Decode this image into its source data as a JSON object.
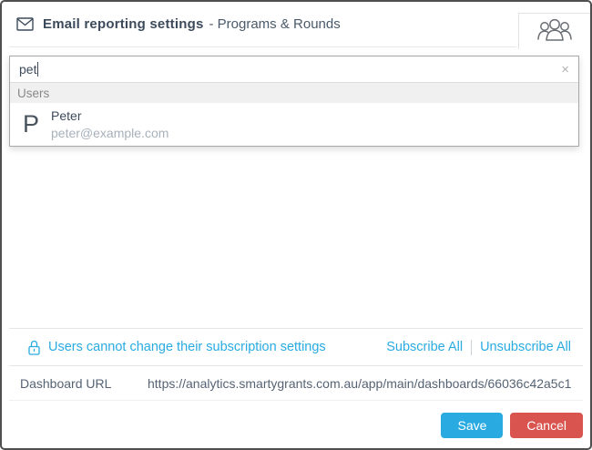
{
  "header": {
    "title": "Email reporting settings",
    "subtitle": "- Programs & Rounds"
  },
  "search": {
    "value": "pet",
    "clear_icon": "×"
  },
  "dropdown": {
    "group_label": "Users",
    "results": [
      {
        "avatar": "P",
        "name": "Peter",
        "email": "peter@example.com"
      }
    ]
  },
  "subscription": {
    "lock_text": "Users cannot change their subscription settings",
    "subscribe_all": "Subscribe All",
    "unsubscribe_all": "Unsubscribe All"
  },
  "dashboard": {
    "label": "Dashboard URL",
    "url": "https://analytics.smartygrants.com.au/app/main/dashboards/66036c42a5c1"
  },
  "footer": {
    "save": "Save",
    "cancel": "Cancel"
  },
  "colors": {
    "accent_blue": "#29abe2",
    "danger_red": "#d9534f",
    "text_dark": "#3d4a5c",
    "text_muted": "#a8b2bc"
  }
}
